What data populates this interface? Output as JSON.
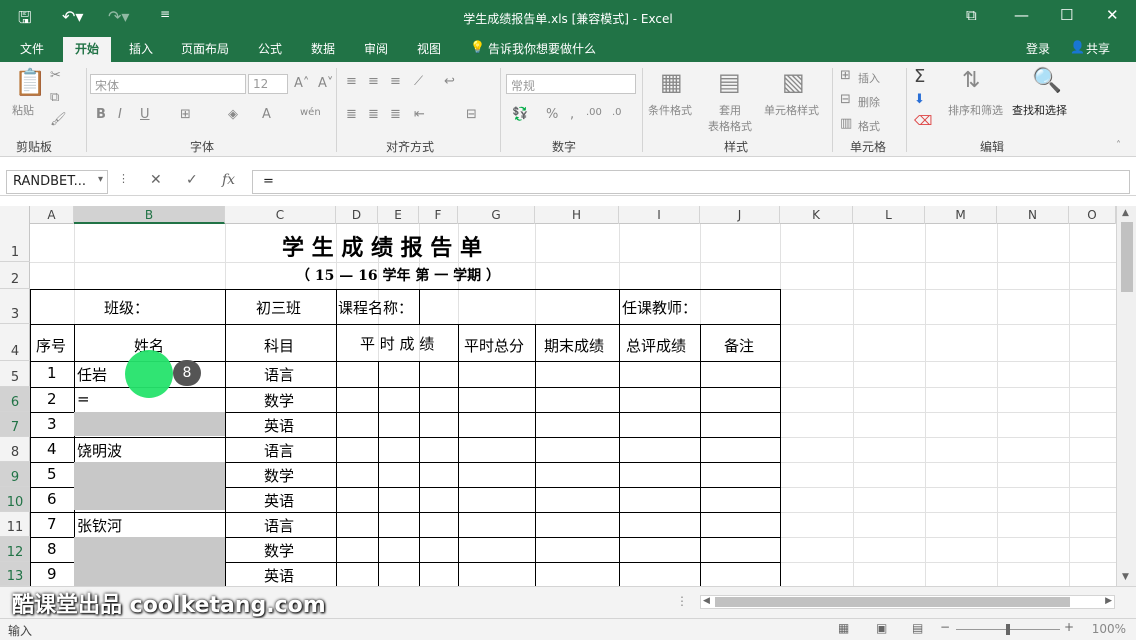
{
  "window": {
    "title": "学生成绩报告单.xls  [兼容模式] - Excel"
  },
  "quick_access": {
    "save_icon": "save-icon",
    "undo_icon": "undo-icon",
    "redo_icon": "redo-icon"
  },
  "tabs": [
    "文件",
    "开始",
    "插入",
    "页面布局",
    "公式",
    "数据",
    "审阅",
    "视图"
  ],
  "active_tab": "开始",
  "tell_me": "告诉我你想要做什么",
  "account": {
    "login": "登录",
    "share": "共享"
  },
  "ribbon": {
    "groups": [
      "剪贴板",
      "字体",
      "对齐方式",
      "数字",
      "样式",
      "单元格",
      "编辑"
    ],
    "paste": "粘贴",
    "font_name": "宋体",
    "font_size": "12",
    "number_format": "常规",
    "cond_format": "条件格式",
    "table_format": "套用\n表格格式",
    "cell_style": "单元格样式",
    "insert": "插入",
    "delete": "删除",
    "format": "格式",
    "sort_filter": "排序和筛选",
    "find_select": "查找和选择"
  },
  "formula_bar": {
    "name_box": "RANDBET...",
    "formula": "="
  },
  "columns": [
    "A",
    "B",
    "C",
    "D",
    "E",
    "F",
    "G",
    "H",
    "I",
    "J",
    "K",
    "L",
    "M",
    "N",
    "O"
  ],
  "rows": [
    "1",
    "2",
    "3",
    "4",
    "5",
    "6",
    "7",
    "8",
    "9",
    "10",
    "11",
    "12",
    "13"
  ],
  "sheet": {
    "title": "学 生 成 绩 报 告 单",
    "subtitle": "（ 15 — 16   学年 第 一 学期 ）",
    "class_label": "班级：",
    "class_value": "初三班",
    "course_label": "课程名称：",
    "teacher_label": "任课教师：",
    "headers": [
      "序号",
      "姓名",
      "科目",
      "平 时 成 绩",
      "平时总分",
      "期末成绩",
      "总评成绩",
      "备注"
    ],
    "data_rows": [
      {
        "no": "1",
        "name": "任岩",
        "subject": "语言"
      },
      {
        "no": "2",
        "name": "=",
        "subject": "数学"
      },
      {
        "no": "3",
        "name": "",
        "subject": "英语"
      },
      {
        "no": "4",
        "name": "饶明波",
        "subject": "语言"
      },
      {
        "no": "5",
        "name": "",
        "subject": "数学"
      },
      {
        "no": "6",
        "name": "",
        "subject": "英语"
      },
      {
        "no": "7",
        "name": "张钦河",
        "subject": "语言"
      },
      {
        "no": "8",
        "name": "",
        "subject": "数学"
      },
      {
        "no": "9",
        "name": "",
        "subject": "英语"
      }
    ]
  },
  "click_badge": "8",
  "watermark": "酷课堂出品 coolketang.com",
  "status": {
    "mode": "输入",
    "zoom": "100%"
  }
}
